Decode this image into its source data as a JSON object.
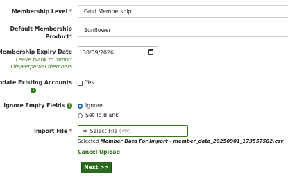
{
  "membership_level": {
    "label": "Membership Level",
    "required_mark": "*",
    "value": "Gold Membership"
  },
  "default_product": {
    "label_line1": "Default Membership",
    "label_line2": "Product",
    "required_mark": "*",
    "value": "Sunflower"
  },
  "expiry_date": {
    "label": "Membership Expiry Date",
    "hint_line1": "Leave blank to import",
    "hint_line2": "Life/Perpetual members",
    "value": "30/09/2026"
  },
  "update_existing": {
    "label": "Update Existing Accounts",
    "option_label": "Yes",
    "checked": false
  },
  "ignore_empty": {
    "label": "Ignore Empty Fields",
    "options": [
      "Ignore",
      "Set To Blank"
    ],
    "selected": "Ignore"
  },
  "import_file": {
    "label": "Import File",
    "required_mark": "*",
    "button_label": "Select File",
    "accept_hint": "(.csv)",
    "selected_prefix": "Selected",
    "selected_name": "Member Data For Import - member_data_20250901_173557502.csv",
    "cancel_label": "Cancel Upload"
  },
  "next_button": {
    "label": "Next >>"
  },
  "icons": {
    "info": "info-icon",
    "calendar": "calendar-icon",
    "plus": "plus-icon"
  },
  "colors": {
    "accent_green": "#2b6a1c",
    "required_red": "#c0392b",
    "radio_blue": "#1565c0"
  }
}
